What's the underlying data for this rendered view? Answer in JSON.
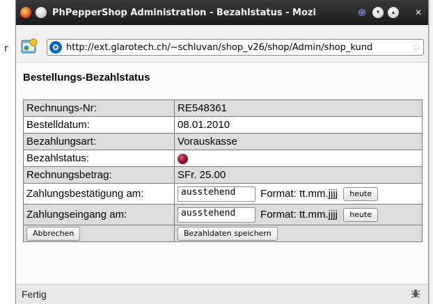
{
  "window": {
    "title": "PhPepperShop Administration - Bezahlstatus - Mozi",
    "controls": {
      "minimize_icon": "chevron-down-icon",
      "maximize_icon": "chevron-up-icon",
      "close_icon": "close-icon",
      "close_glyph": "✕"
    }
  },
  "navigation": {
    "url": "http://ext.glarotech.ch/~schluvan/shop_v26/shop/Admin/shop_kund"
  },
  "page": {
    "title": "Bestellungs-Bezahlstatus",
    "rows": [
      {
        "label": "Rechnungs-Nr:",
        "value": "RE548361"
      },
      {
        "label": "Bestelldatum:",
        "value": "08.01.2010"
      },
      {
        "label": "Bezahlungsart:",
        "value": "Vorauskasse"
      },
      {
        "label": "Bezahlstatus:",
        "indicator_color": "#8b0a2a"
      },
      {
        "label": "Rechnungsbetrag:",
        "value": "SFr. 25.00"
      }
    ],
    "payment_confirmation": {
      "label": "Zahlungsbestätigung am:",
      "input_value": "ausstehend",
      "format_text": "Format: tt.mm.jjjj",
      "today_label": "heute"
    },
    "payment_receipt": {
      "label": "Zahlungseingang am:",
      "input_value": "ausstehend",
      "format_text": "Format: tt.mm.jjjj",
      "today_label": "heute"
    },
    "cancel_label": "Abbrechen",
    "save_label": "Bezahldaten speichern"
  },
  "status_bar": {
    "text": "Fertig"
  },
  "background": {
    "glyph": "r"
  },
  "colors": {
    "titlebar": "#2a2a2a",
    "row_grey": "#dcdcdc",
    "row_white": "#ffffff",
    "status_dot": "#8b0a2a"
  }
}
